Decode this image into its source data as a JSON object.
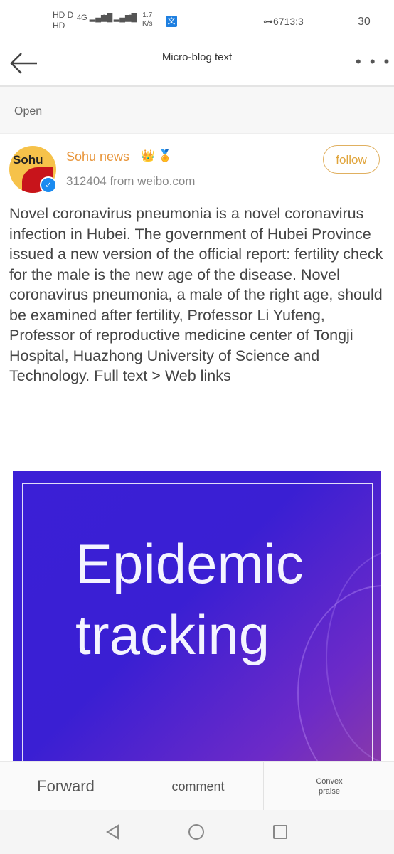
{
  "status_bar": {
    "network_left_top": "HD D",
    "network_left_bottom": "HD",
    "signal1": "4G",
    "signal2": "4G",
    "speed_value": "1.7",
    "speed_unit": "K/s",
    "app_icon": "文",
    "key_battery": "⊶6713:3",
    "time": "30"
  },
  "appbar": {
    "title": "Micro-blog text",
    "back_icon": "arrow-left-icon",
    "more_icon": "more-horizontal-icon",
    "more_label": "• • •"
  },
  "banner": {
    "open_label": "Open"
  },
  "post": {
    "avatar_text": "Sohu",
    "author": "Sohu news",
    "badges": "👑 🏅",
    "meta": "312404 from weibo.com",
    "follow_label": "follow",
    "body": "Novel coronavirus pneumonia is a novel coronavirus infection in Hubei. The government of Hubei Province issued a new version of the official report: fertility check for the male is the new age of the disease. Novel coronavirus pneumonia, a male of the right age, should be examined after fertility, Professor Li Yufeng, Professor of reproductive medicine center of Tongji Hospital, Huazhong University of Science and Technology. Full text > Web links",
    "image_title": "Epidemic tracking"
  },
  "bottom_bar": {
    "forward": "Forward",
    "comment": "comment",
    "praise": "Convex praise"
  },
  "colors": {
    "author": "#e8953a",
    "follow": "#e0a43a",
    "image_bg": "#3b1fd6",
    "verified": "#1b8bf0"
  }
}
